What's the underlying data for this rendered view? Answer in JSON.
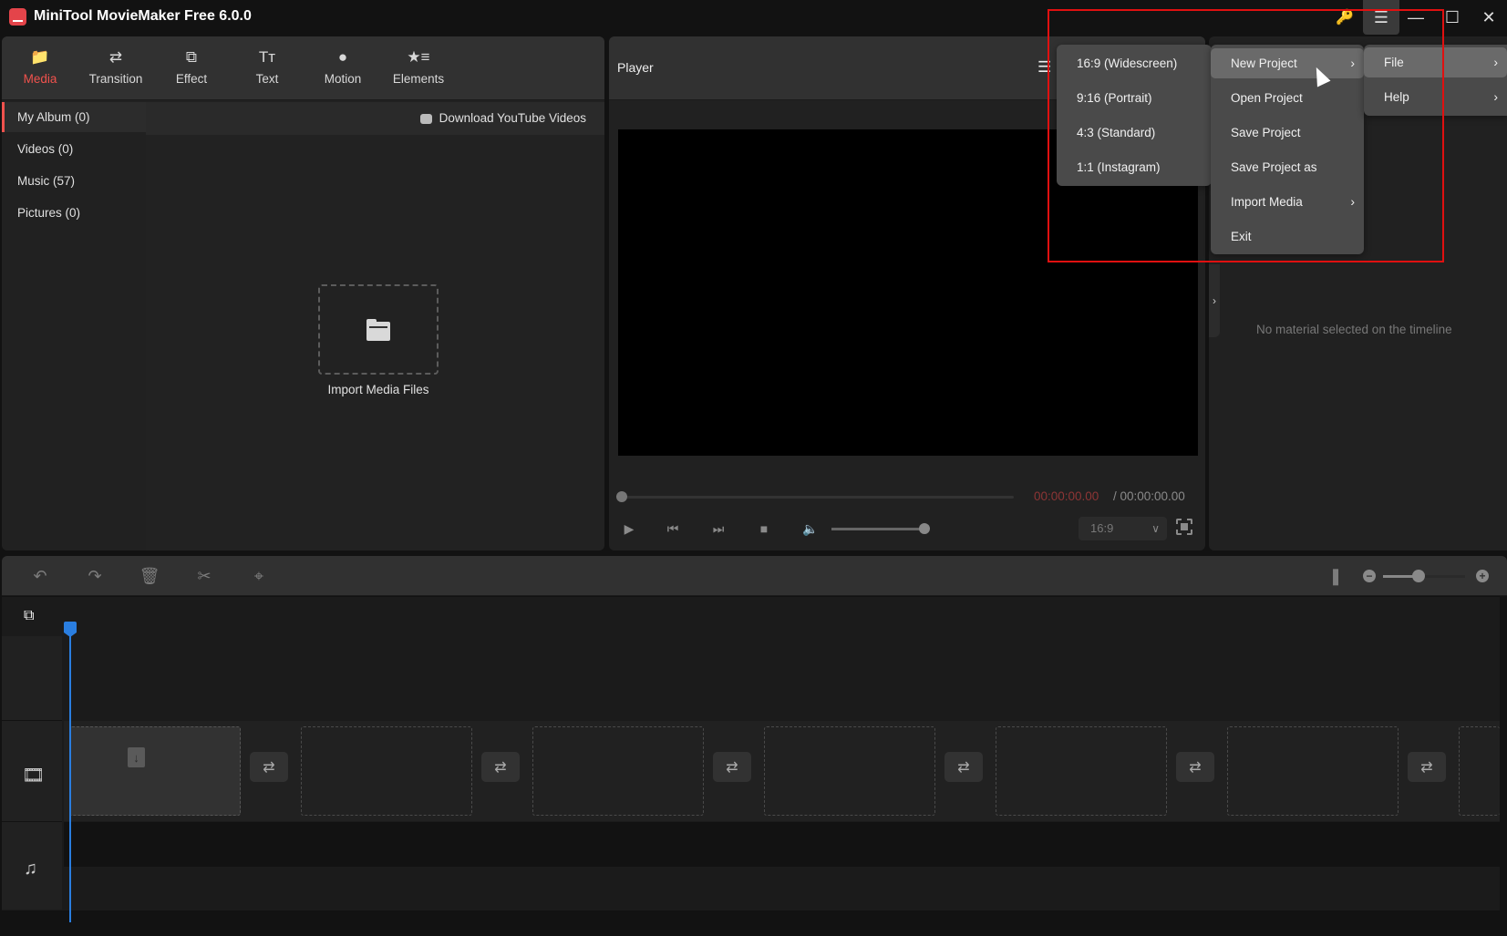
{
  "window": {
    "title": "MiniTool MovieMaker Free 6.0.0",
    "controls": [
      "key-icon",
      "menu-icon",
      "minimize-icon",
      "maximize-icon",
      "close-icon"
    ]
  },
  "toolbar": {
    "tabs": [
      {
        "label": "Media",
        "icon": "folder-icon",
        "active": true
      },
      {
        "label": "Transition",
        "icon": "swap-arrows-icon"
      },
      {
        "label": "Effect",
        "icon": "stacked-squares-icon"
      },
      {
        "label": "Text",
        "icon": "text-icon"
      },
      {
        "label": "Motion",
        "icon": "motion-ball-icon"
      },
      {
        "label": "Elements",
        "icon": "star-list-icon"
      }
    ]
  },
  "media": {
    "sidebar": [
      {
        "label": "My Album (0)",
        "active": true
      },
      {
        "label": "Videos (0)"
      },
      {
        "label": "Music (57)"
      },
      {
        "label": "Pictures (0)"
      }
    ],
    "download_label": "Download YouTube Videos",
    "import_label": "Import Media Files"
  },
  "player": {
    "title": "Player",
    "time_current": "00:00:00.00",
    "time_total": "/ 00:00:00.00",
    "aspect_ratio": "16:9",
    "progress": 0,
    "volume": 1.0
  },
  "properties": {
    "empty_text": "No material selected on the timeline"
  },
  "timeline": {
    "zoom_level": 0.45,
    "clip_slots": 7,
    "tracks": [
      "video-track",
      "audio-track"
    ]
  },
  "menus": {
    "main": [
      {
        "label": "File",
        "has_submenu": true,
        "hover": true
      },
      {
        "label": "Help",
        "has_submenu": true
      }
    ],
    "file": [
      {
        "label": "New Project",
        "has_submenu": true,
        "hover": true
      },
      {
        "label": "Open Project"
      },
      {
        "label": "Save Project"
      },
      {
        "label": "Save Project as"
      },
      {
        "label": "Import Media",
        "has_submenu": true
      },
      {
        "label": "Exit"
      }
    ],
    "new_project": [
      {
        "label": "16:9 (Widescreen)"
      },
      {
        "label": "9:16 (Portrait)"
      },
      {
        "label": "4:3 (Standard)"
      },
      {
        "label": "1:1 (Instagram)"
      }
    ]
  },
  "colors": {
    "accent": "#f0524d",
    "playhead": "#2a7ee0",
    "time_current": "#8d3535",
    "key": "#f3b31a",
    "highlight": "#e01010"
  }
}
